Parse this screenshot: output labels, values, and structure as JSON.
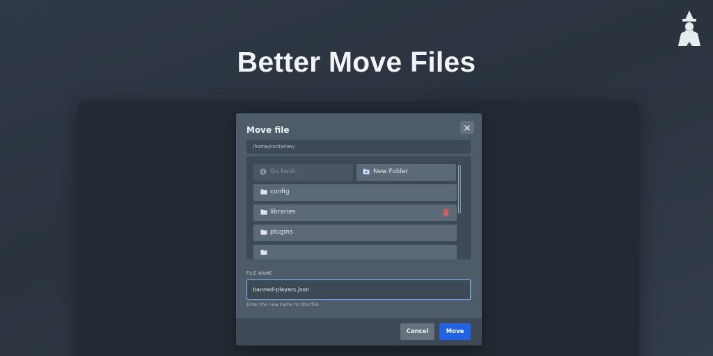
{
  "banner": {
    "title": "Better Move Files"
  },
  "modal": {
    "title": "Move file",
    "path": "/home/container/",
    "go_back_label": "Go back",
    "new_folder_label": "New Folder",
    "folders": [
      {
        "name": "config"
      },
      {
        "name": "libraries"
      },
      {
        "name": "plugins"
      }
    ],
    "file_name_label": "FILE NAME",
    "file_name_value": "banned-players.json",
    "help_text": "Enter the new name for this file.",
    "cancel_label": "Cancel",
    "move_label": "Move"
  },
  "icons": {
    "logo": "wizard-logo",
    "close": "close-icon",
    "go_back": "arrow-circle-left-icon",
    "new_folder": "folder-plus-icon",
    "folder": "folder-icon",
    "trash": "trash-icon"
  },
  "colors": {
    "primary": "#2163e3",
    "danger": "#e05a5a",
    "modal_bg": "#4e5b68",
    "item_bg": "#5c6a78"
  }
}
